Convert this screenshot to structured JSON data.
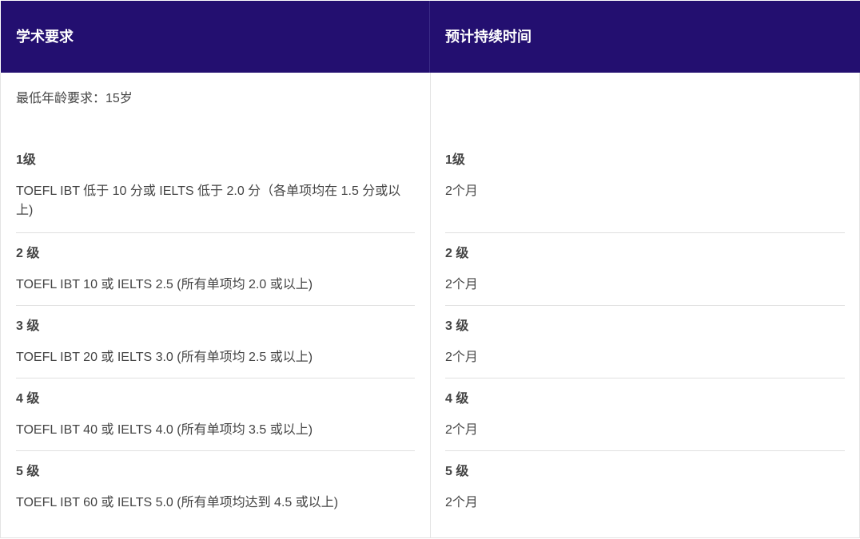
{
  "header": {
    "academic_requirements": "学术要求",
    "expected_duration": "预计持续时间"
  },
  "min_age": "最低年龄要求：15岁",
  "levels": [
    {
      "level": "1级",
      "requirement": "TOEFL IBT 低于 10 分或 IELTS 低于 2.0 分（各单项均在 1.5 分或以上)",
      "duration_level": "1级",
      "duration": "2个月"
    },
    {
      "level": "2 级",
      "requirement": "TOEFL IBT 10 或 IELTS 2.5 (所有单项均 2.0 或以上)",
      "duration_level": "2 级",
      "duration": "2个月"
    },
    {
      "level": "3 级",
      "requirement": "TOEFL IBT 20 或 IELTS 3.0 (所有单项均 2.5 或以上)",
      "duration_level": "3 级",
      "duration": "2个月"
    },
    {
      "level": "4 级",
      "requirement": "TOEFL IBT 40 或 IELTS 4.0 (所有单项均 3.5 或以上)",
      "duration_level": "4 级",
      "duration": "2个月"
    },
    {
      "level": "5 级",
      "requirement": "TOEFL IBT 60 或 IELTS 5.0 (所有单项均达到 4.5 或以上)",
      "duration_level": "5 级",
      "duration": "2个月"
    }
  ],
  "colors": {
    "header_bg": "#230f70",
    "header_text": "#ffffff",
    "body_text": "#444444",
    "divider": "#e0e0e0"
  }
}
